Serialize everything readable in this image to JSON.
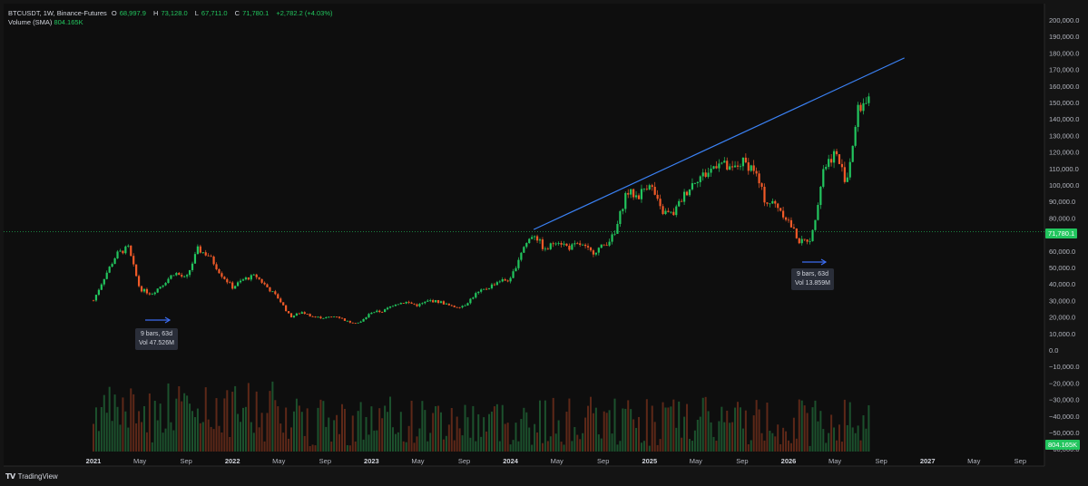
{
  "header": {
    "symbol": "BTCUSDT, 1W, Binance-Futures",
    "o_label": "O",
    "o_value": "68,997.9",
    "h_label": "H",
    "h_value": "73,128.0",
    "l_label": "L",
    "l_value": "67,711.0",
    "c_label": "C",
    "c_value": "71,780.1",
    "change": "+2,782.2 (+4.03%)",
    "volume_label": "Volume (SMA)",
    "volume_value": "804.165K"
  },
  "price_axis": {
    "labels": [
      "200,000.0",
      "190,000.0",
      "180,000.0",
      "170,000.0",
      "160,000.0",
      "150,000.0",
      "140,000.0",
      "130,000.0",
      "120,000.0",
      "110,000.0",
      "100,000.0",
      "90,000.0",
      "80,000.0",
      "70,000.0",
      "60,000.0",
      "50,000.0",
      "40,000.0",
      "30,000.0",
      "20,000.0",
      "10,000.0",
      "0.0",
      "−10,000.0",
      "−20,000.0",
      "−30,000.0",
      "−40,000.0",
      "−50,000.0",
      "−60,000.0"
    ],
    "current_price": "71,780.1",
    "volume_tag": "804.165K"
  },
  "time_axis": {
    "labels": [
      "2021",
      "May",
      "Sep",
      "2022",
      "May",
      "Sep",
      "2023",
      "May",
      "Sep",
      "2024",
      "May",
      "Sep",
      "2025",
      "May",
      "Sep",
      "2026",
      "May",
      "Sep",
      "2027",
      "May",
      "Sep"
    ],
    "year_labels": [
      "2021",
      "2022",
      "2023",
      "2024",
      "2025",
      "2026",
      "2027"
    ]
  },
  "measures": [
    {
      "line1": "9 bars, 63d",
      "line2": "Vol 47.526M"
    },
    {
      "line1": "9 bars, 63d",
      "line2": "Vol 13.859M"
    }
  ],
  "colors": {
    "up": "#22c55e",
    "down": "#f05a28",
    "trendline": "#3b82f6",
    "price_line": "#22c55e",
    "measure_arrow": "#3b6cf0"
  },
  "footer": {
    "brand": "TradingView"
  },
  "chart_data": {
    "type": "candlestick",
    "interval": "1W",
    "ylim": [
      -60000,
      200000
    ],
    "xlim": [
      "2021-01",
      "2027-09"
    ],
    "trendline": {
      "from": {
        "date": "2024-03",
        "price": 73000
      },
      "to": {
        "date": "2026-11",
        "price": 177000
      }
    },
    "closes_approx": [
      {
        "date": "2021-01",
        "close": 30000
      },
      {
        "date": "2021-02",
        "close": 45000
      },
      {
        "date": "2021-03",
        "close": 58000
      },
      {
        "date": "2021-04",
        "close": 62000
      },
      {
        "date": "2021-05",
        "close": 37000
      },
      {
        "date": "2021-06",
        "close": 34000
      },
      {
        "date": "2021-07",
        "close": 40000
      },
      {
        "date": "2021-08",
        "close": 47000
      },
      {
        "date": "2021-09",
        "close": 43000
      },
      {
        "date": "2021-10",
        "close": 61000
      },
      {
        "date": "2021-11",
        "close": 57000
      },
      {
        "date": "2021-12",
        "close": 46000
      },
      {
        "date": "2022-01",
        "close": 38000
      },
      {
        "date": "2022-02",
        "close": 43000
      },
      {
        "date": "2022-03",
        "close": 45000
      },
      {
        "date": "2022-04",
        "close": 38000
      },
      {
        "date": "2022-05",
        "close": 31000
      },
      {
        "date": "2022-06",
        "close": 20000
      },
      {
        "date": "2022-07",
        "close": 23000
      },
      {
        "date": "2022-08",
        "close": 20000
      },
      {
        "date": "2022-09",
        "close": 19500
      },
      {
        "date": "2022-10",
        "close": 20500
      },
      {
        "date": "2022-11",
        "close": 17000
      },
      {
        "date": "2022-12",
        "close": 16500
      },
      {
        "date": "2023-01",
        "close": 23000
      },
      {
        "date": "2023-02",
        "close": 23500
      },
      {
        "date": "2023-03",
        "close": 28000
      },
      {
        "date": "2023-04",
        "close": 29000
      },
      {
        "date": "2023-05",
        "close": 27000
      },
      {
        "date": "2023-06",
        "close": 30000
      },
      {
        "date": "2023-07",
        "close": 29000
      },
      {
        "date": "2023-08",
        "close": 26000
      },
      {
        "date": "2023-09",
        "close": 27000
      },
      {
        "date": "2023-10",
        "close": 34000
      },
      {
        "date": "2023-11",
        "close": 37500
      },
      {
        "date": "2023-12",
        "close": 42000
      },
      {
        "date": "2024-01",
        "close": 42500
      },
      {
        "date": "2024-02",
        "close": 61000
      },
      {
        "date": "2024-03",
        "close": 71000
      },
      {
        "date": "2024-04",
        "close": 60000
      },
      {
        "date": "2024-05",
        "close": 67000
      },
      {
        "date": "2024-06",
        "close": 62000
      },
      {
        "date": "2024-07",
        "close": 64000
      },
      {
        "date": "2024-08",
        "close": 59000
      },
      {
        "date": "2024-09",
        "close": 63000
      },
      {
        "date": "2024-10",
        "close": 70000
      },
      {
        "date": "2024-11",
        "close": 96000
      },
      {
        "date": "2024-12",
        "close": 93000
      },
      {
        "date": "2025-01",
        "close": 102000
      },
      {
        "date": "2025-02",
        "close": 84000
      },
      {
        "date": "2025-03",
        "close": 82000
      },
      {
        "date": "2025-04",
        "close": 94000
      },
      {
        "date": "2025-05",
        "close": 104000
      },
      {
        "date": "2025-06",
        "close": 107000
      },
      {
        "date": "2025-07",
        "close": 115000
      },
      {
        "date": "2025-08",
        "close": 108000
      },
      {
        "date": "2025-09",
        "close": 114000
      },
      {
        "date": "2025-10",
        "close": 110000
      },
      {
        "date": "2025-11",
        "close": 90000
      },
      {
        "date": "2025-12",
        "close": 88000
      },
      {
        "date": "2026-01",
        "close": 78000
      },
      {
        "date": "2026-02",
        "close": 65000
      },
      {
        "date": "2026-03",
        "close": 68000
      },
      {
        "date": "2026-04",
        "close": 110000
      },
      {
        "date": "2026-05",
        "close": 120000
      },
      {
        "date": "2026-06",
        "close": 102000
      },
      {
        "date": "2026-07",
        "close": 145000
      },
      {
        "date": "2026-08",
        "close": 155000
      }
    ]
  }
}
